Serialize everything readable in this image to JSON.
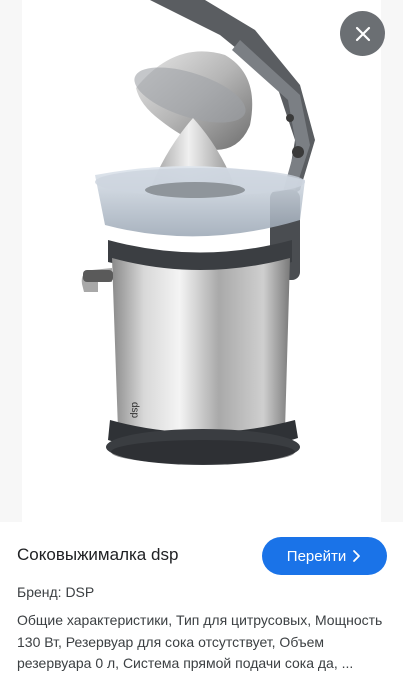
{
  "product": {
    "image_alt": "juicer-product-image",
    "logo_text": "dsp",
    "title": "Соковыжималка dsp",
    "brand": "Бренд: DSP",
    "description": "Общие характеристики, Тип для цитрусовых, Мощность 130 Вт, Резервуар для сока отсутствует, Объем резервуара 0 л, Система прямой подачи сока да, ..."
  },
  "actions": {
    "go_label": "Перейти",
    "go_icon": "chevron-right-icon",
    "close_icon": "close-icon"
  },
  "colors": {
    "accent": "#1a73e8",
    "close_bg": "#5f6368"
  }
}
